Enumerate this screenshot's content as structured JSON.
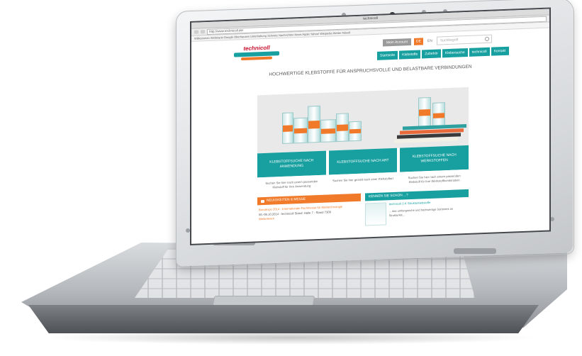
{
  "browser": {
    "window_title": "technicoll",
    "address": "http://www.technicoll.de/",
    "bookmarks": "Willkommen  Weltmarkt  Google  Oberhausen  Unterhaltung  Schweiz  Nachrichten  News  Apple  Yahoo!  Wikipedia  Wetter  Aktuell"
  },
  "site": {
    "logo_text": "technicoll",
    "login_label": "Mein Account",
    "lang_de": "DE",
    "lang_en": "EN",
    "search_placeholder": "Suchbegriff",
    "nav": [
      "Startseite",
      "Klebstoffe",
      "Zubehör",
      "Klebersuche",
      "technicoll",
      "Kontakt"
    ],
    "headline": "HOCHWERTIGE KLEBSTOFFE FÜR ANSPRUCHSVOLLE UND BELASTBARE VERBINDUNGEN",
    "cards": [
      {
        "title": "KLEBSTOFFSUCHE NACH ANWENDUNG",
        "text": "Suchen Sie hier nach einem passenden Klebstoff für Ihre Anwendung"
      },
      {
        "title": "KLEBSTOFFSUCHE NACH ART",
        "text": "Suchen Sie hier gezielt nach einer Klebstoffart"
      },
      {
        "title": "KLEBSTOFFSUCHE NACH WERKSTOFFEN",
        "text": "Suchen Sie hier nach einem passenden Klebstoff für Ihre Werkstoffkombination"
      }
    ],
    "news": {
      "heading": "NEUIGKEITEN & MESSE",
      "item": "Bondexpo 2014 - Internationale Fachmesse für Klebtechnologie",
      "date": "06.-09.10.2014 - technicoll Stand: Halle 7 - Stand 7309",
      "link": "Weiterlesen"
    },
    "kennen": {
      "heading": "KENNEN SIE SCHON ...?",
      "title": "technicoll 2-K Strukturklebstoffe",
      "text": "... das umfangreiche und hochwertige Sortiment an Strukturkle..."
    }
  },
  "colors": {
    "brand_teal": "#18a0a0",
    "brand_orange": "#f07a2a",
    "logo_red": "#c8102e"
  }
}
